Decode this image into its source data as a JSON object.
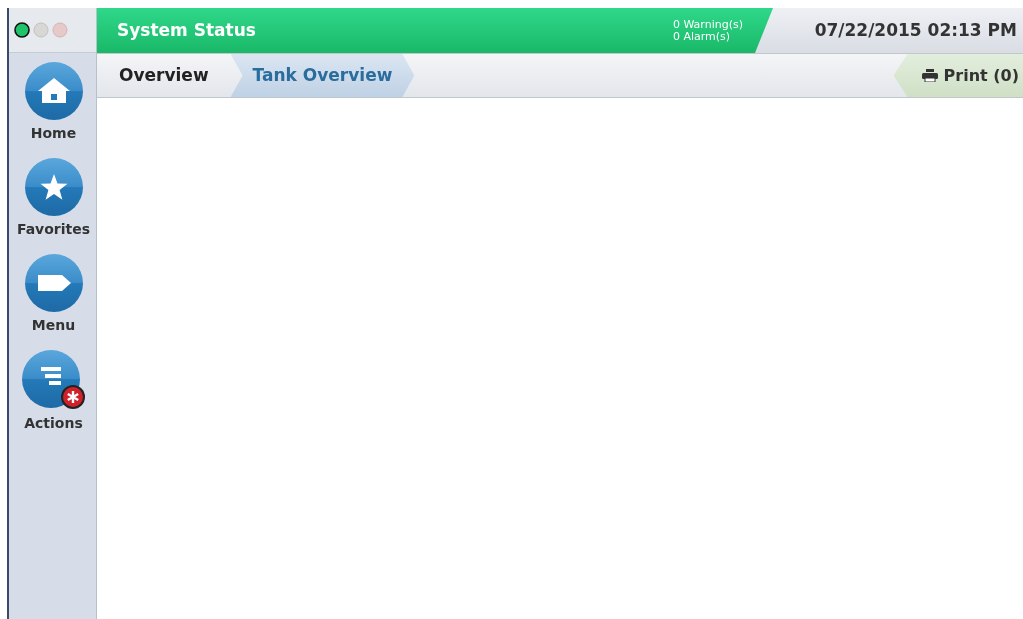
{
  "header": {
    "title": "System Status",
    "warnings": "0 Warning(s)",
    "alarms": "0 Alarm(s)",
    "datetime": "07/22/2015 02:13 PM"
  },
  "breadcrumbs": [
    {
      "label": "Overview",
      "selected": false
    },
    {
      "label": "Tank Overview",
      "selected": true
    }
  ],
  "print": {
    "label": "Print (0)"
  },
  "nav": [
    {
      "kind": "home",
      "label": "Home"
    },
    {
      "kind": "favorites",
      "label": "Favorites"
    },
    {
      "kind": "menu",
      "label": "Menu"
    },
    {
      "kind": "actions",
      "label": "Actions"
    }
  ]
}
